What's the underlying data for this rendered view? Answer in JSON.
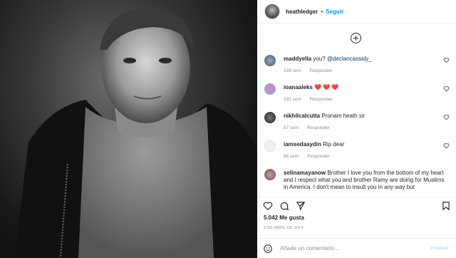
{
  "post": {
    "username": "heathledger",
    "separator": "•",
    "follow_label": "Seguir",
    "likes": "5.042 Me gusta",
    "date": "8 DE ABRIL DE 2014"
  },
  "comments": [
    {
      "user": "maddyella",
      "text": "you?",
      "mention": "@declancassidy_",
      "time": "199 sem",
      "reply": "Responder"
    },
    {
      "user": "ioanaaleks",
      "text": "❤️❤️❤️",
      "time": "192 sem",
      "reply": "Responder"
    },
    {
      "user": "nikhilcalcutta",
      "text": "Pronam heath sir",
      "time": "87 sem",
      "reply": "Responder"
    },
    {
      "user": "iamsedaaydin",
      "text": "Rip dear",
      "time": "66 sem",
      "reply": "Responder"
    },
    {
      "user": "selinamayanow",
      "text": "Brother I love you from the bottom of my heart and I respect what you and brother Ramy are doing for Muslims in America. I don't mean to insult you in any way but"
    }
  ],
  "composer": {
    "placeholder": "Añade un comentario...",
    "publish_label": "Publicar"
  },
  "icons": [
    "heart-icon",
    "comment-icon",
    "share-icon",
    "bookmark-icon",
    "emoji-icon",
    "load-more-icon"
  ],
  "colors": {
    "accent": "#0095f6",
    "text": "#262626",
    "muted": "#8e8e8e",
    "mention": "#00376b"
  }
}
